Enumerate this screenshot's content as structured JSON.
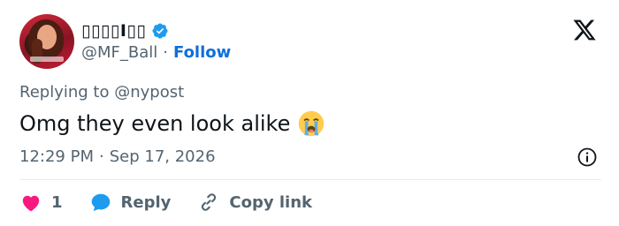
{
  "author": {
    "display_name": "▯▯▯▯I▯▯",
    "handle": "@MF_Ball",
    "separator": "·",
    "follow_label": "Follow",
    "verified_color": "#1d9bf0"
  },
  "reply": {
    "prefix": "Replying to",
    "to_handle": "@nypost"
  },
  "tweet": {
    "text": "Omg they even look alike",
    "emoji": "loudly-crying-face"
  },
  "meta": {
    "time": "12:29 PM",
    "separator": "·",
    "date": "Sep 17, 2026"
  },
  "actions": {
    "like_count": "1",
    "reply_label": "Reply",
    "copy_link_label": "Copy link"
  },
  "colors": {
    "like": "#f91880",
    "reply": "#1d9bf0",
    "follow": "#0f6fd8",
    "secondary_text": "#536471"
  }
}
